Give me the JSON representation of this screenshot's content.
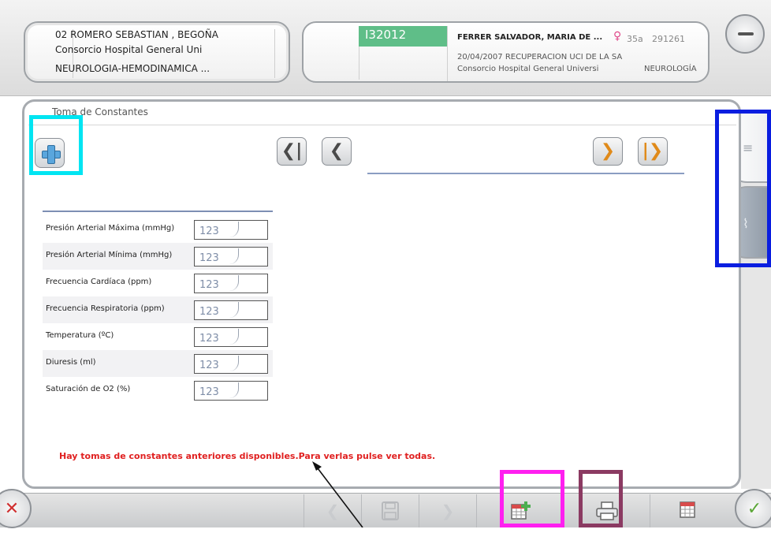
{
  "patient": {
    "name": "02 ROMERO SEBASTIAN , BEGOÑA",
    "hospital": "Consorcio Hospital General Uni",
    "service": "NEUROLOGIA-HEMODINAMICA ..."
  },
  "episode": {
    "id": "I32012",
    "name": "FERRER SALVADOR, MARIA DE ...",
    "gender_symbol": "♀",
    "age": "35a",
    "number": "291261",
    "date_unit": "20/04/2007  RECUPERACION UCI DE LA SA",
    "hospital": "Consorcio Hospital General Universi",
    "specialty": "NEUROLOGÍA"
  },
  "panel": {
    "title": "Toma de Constantes",
    "warning": "Hay tomas de constantes anteriores disponibles.Para verlas pulse ver todas."
  },
  "vitals": [
    {
      "label": "Presión Arterial Máxima  (mmHg)",
      "placeholder": "123"
    },
    {
      "label": "Presión Arterial Mínima  (mmHg)",
      "placeholder": "123"
    },
    {
      "label": "Frecuencia Cardíaca  (ppm)",
      "placeholder": "123"
    },
    {
      "label": "Frecuencia Respiratoria  (ppm)",
      "placeholder": "123"
    },
    {
      "label": "Temperatura  (ºC)",
      "placeholder": "123"
    },
    {
      "label": "Diuresis  (ml)",
      "placeholder": "123"
    },
    {
      "label": "Saturación de O2  (%)",
      "placeholder": "123"
    }
  ],
  "icons": {
    "add": "plus-icon",
    "first": "first-page-icon",
    "prev": "previous-icon",
    "next": "next-icon",
    "last": "last-page-icon",
    "list_view": "list-icon",
    "chart_view": "chart-icon",
    "close": "close-icon",
    "save": "save-icon",
    "add_calendar": "calendar-add-icon",
    "print": "printer-icon",
    "calendar": "calendar-icon",
    "accept": "check-icon"
  },
  "colors": {
    "episode_id_bg": "#5fbe88",
    "warning_text": "#e02020",
    "nav_orange": "#e08a1a",
    "highlight_cyan": "#00e5f2",
    "highlight_blue": "#0a1ee0",
    "highlight_magenta": "#ff1ff0",
    "highlight_plum": "#8b3a62"
  }
}
